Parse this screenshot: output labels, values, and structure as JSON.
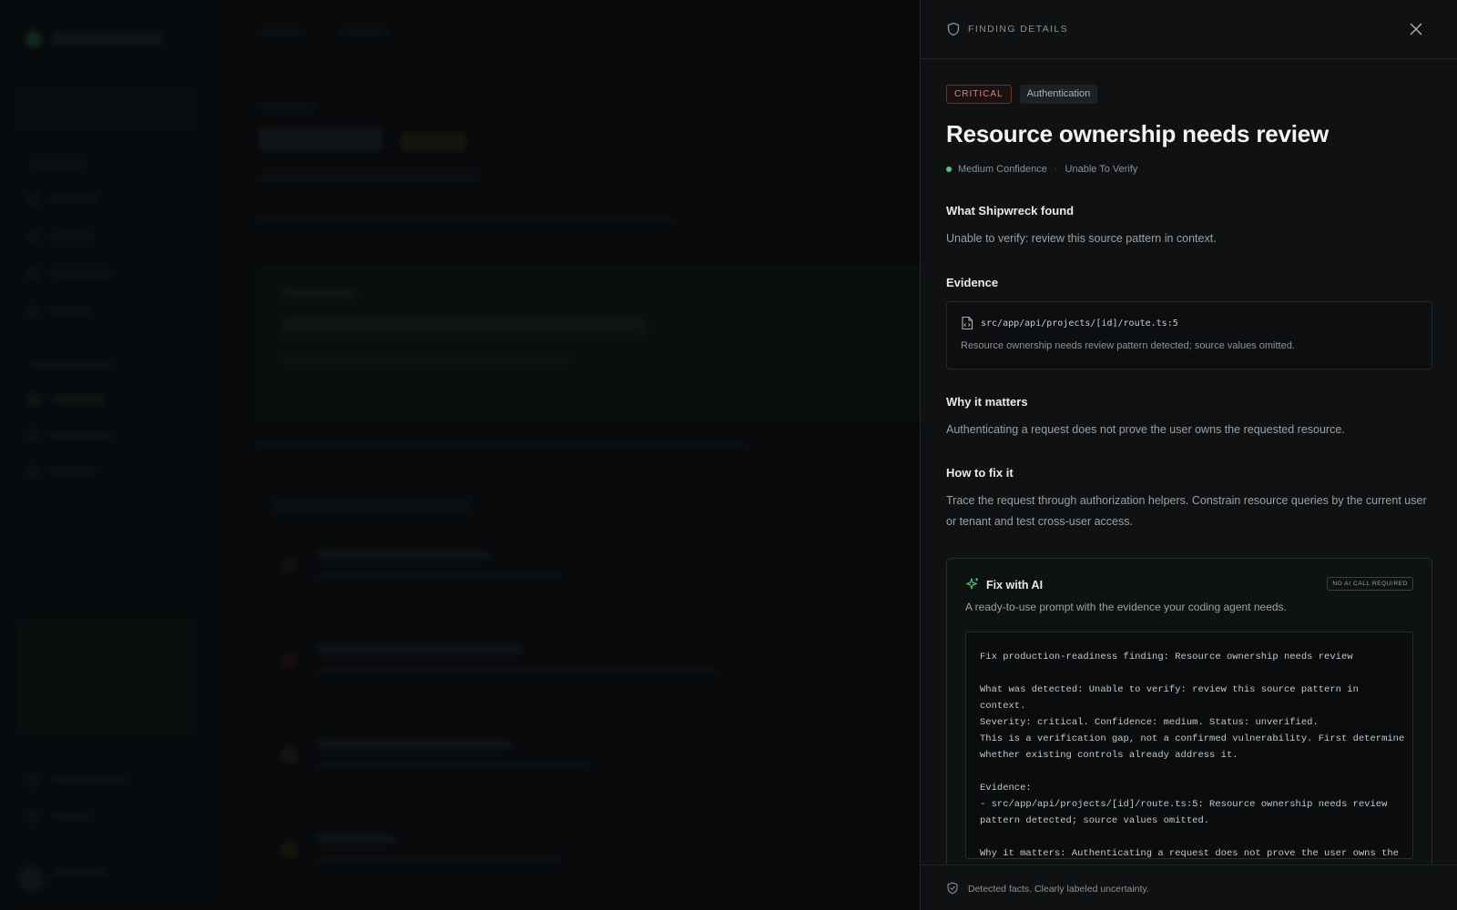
{
  "drawer": {
    "header_title": "FINDING DETAILS",
    "severity_tag": "CRITICAL",
    "category_tag": "Authentication",
    "title": "Resource ownership needs review",
    "confidence": "Medium Confidence",
    "status": "Unable To Verify",
    "found_heading": "What Shipwreck found",
    "found_text": "Unable to verify: review this source pattern in context.",
    "evidence_heading": "Evidence",
    "evidence_path": "src/app/api/projects/[id]/route.ts:5",
    "evidence_desc": "Resource ownership needs review pattern detected; source values omitted.",
    "why_heading": "Why it matters",
    "why_text": "Authenticating a request does not prove the user owns the requested resource.",
    "fix_heading": "How to fix it",
    "fix_text": "Trace the request through authorization helpers. Constrain resource queries by the current user or tenant and test cross-user access.",
    "ai": {
      "title": "Fix with AI",
      "badge": "NO AI CALL REQUIRED",
      "subtitle": "A ready-to-use prompt with the evidence your coding agent needs.",
      "prompt": "Fix production-readiness finding: Resource ownership needs review\n\nWhat was detected: Unable to verify: review this source pattern in context.\nSeverity: critical. Confidence: medium. Status: unverified.\nThis is a verification gap, not a confirmed vulnerability. First determine whether existing controls already address it.\n\nEvidence:\n- src/app/api/projects/[id]/route.ts:5: Resource ownership needs review pattern detected; source values omitted.\n\nWhy it matters: Authenticating a request does not prove the user owns the requested resource."
    },
    "footer": "Detected facts. Clearly labeled uncertainty."
  },
  "colors": {
    "accent_green": "#3fcf7f",
    "critical": "#e0806f"
  },
  "icons": {
    "header": "shield-icon",
    "close": "close-icon",
    "evidence": "file-code-icon",
    "ai": "sparkles-icon",
    "footer": "shield-check-icon"
  }
}
